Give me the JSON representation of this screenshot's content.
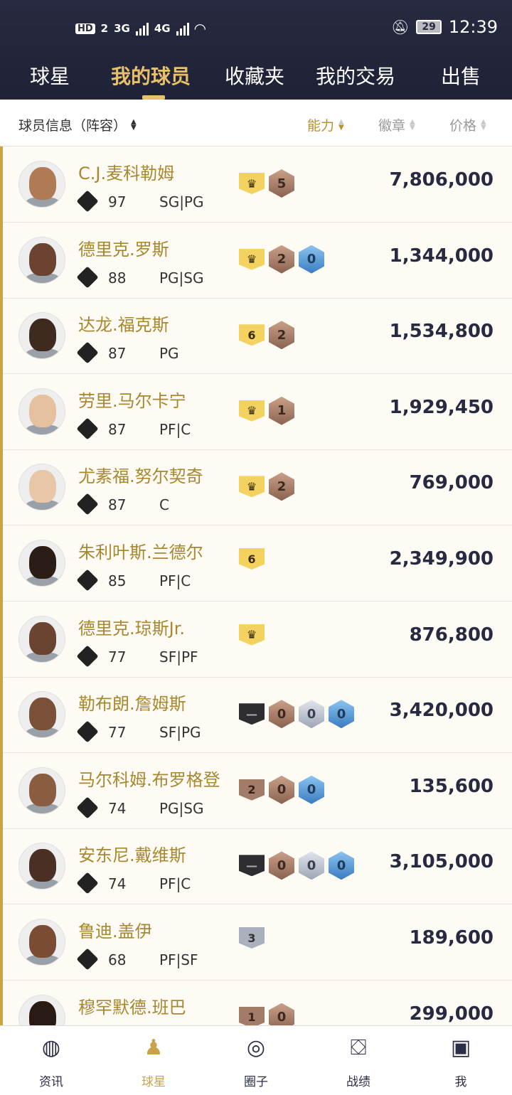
{
  "status_bar": {
    "hd": "HD",
    "sim": "2",
    "net1": "3G",
    "net2": "4G",
    "battery": "29",
    "time": "12:39"
  },
  "top_tabs": [
    "球星",
    "我的球员",
    "收藏夹",
    "我的交易",
    "出售"
  ],
  "sort_bar": {
    "info": "球员信息（阵容）",
    "ability": "能力",
    "badge": "徽章",
    "price": "价格"
  },
  "players": [
    {
      "name": "C.J.麦科勒姆",
      "rating": "97",
      "pos": "SG|PG",
      "price": "7,806,000",
      "badges": [
        {
          "t": "shield",
          "c": "gold",
          "v": "♛"
        },
        {
          "t": "hex",
          "c": "bronze",
          "v": "5"
        }
      ]
    },
    {
      "name": "德里克.罗斯",
      "rating": "88",
      "pos": "PG|SG",
      "price": "1,344,000",
      "badges": [
        {
          "t": "shield",
          "c": "gold",
          "v": "♛"
        },
        {
          "t": "hex",
          "c": "bronze",
          "v": "2"
        },
        {
          "t": "hex",
          "c": "blue",
          "v": "0"
        }
      ]
    },
    {
      "name": "达龙.福克斯",
      "rating": "87",
      "pos": "PG",
      "price": "1,534,800",
      "badges": [
        {
          "t": "shield",
          "c": "gold",
          "v": "6"
        },
        {
          "t": "hex",
          "c": "bronze",
          "v": "2"
        }
      ]
    },
    {
      "name": "劳里.马尔卡宁",
      "rating": "87",
      "pos": "PF|C",
      "price": "1,929,450",
      "badges": [
        {
          "t": "shield",
          "c": "gold",
          "v": "♛"
        },
        {
          "t": "hex",
          "c": "bronze",
          "v": "1"
        }
      ]
    },
    {
      "name": "尤素福.努尔契奇",
      "rating": "87",
      "pos": "C",
      "price": "769,000",
      "badges": [
        {
          "t": "shield",
          "c": "gold",
          "v": "♛"
        },
        {
          "t": "hex",
          "c": "bronze",
          "v": "2"
        }
      ]
    },
    {
      "name": "朱利叶斯.兰德尔",
      "rating": "85",
      "pos": "PF|C",
      "price": "2,349,900",
      "badges": [
        {
          "t": "shield",
          "c": "gold",
          "v": "6"
        }
      ]
    },
    {
      "name": "德里克.琼斯Jr.",
      "rating": "77",
      "pos": "SF|PF",
      "price": "876,800",
      "badges": [
        {
          "t": "shield",
          "c": "gold",
          "v": "♛"
        }
      ]
    },
    {
      "name": "勒布朗.詹姆斯",
      "rating": "77",
      "pos": "SF|PG",
      "price": "3,420,000",
      "badges": [
        {
          "t": "shield",
          "c": "dark",
          "v": "—"
        },
        {
          "t": "hex",
          "c": "bronze",
          "v": "0"
        },
        {
          "t": "hex",
          "c": "silver",
          "v": "0"
        },
        {
          "t": "hex",
          "c": "blue",
          "v": "0"
        }
      ]
    },
    {
      "name": "马尔科姆.布罗格登",
      "rating": "74",
      "pos": "PG|SG",
      "price": "135,600",
      "badges": [
        {
          "t": "shield",
          "c": "bronze",
          "v": "2"
        },
        {
          "t": "hex",
          "c": "bronze",
          "v": "0"
        },
        {
          "t": "hex",
          "c": "blue",
          "v": "0"
        }
      ]
    },
    {
      "name": "安东尼.戴维斯",
      "rating": "74",
      "pos": "PF|C",
      "price": "3,105,000",
      "badges": [
        {
          "t": "shield",
          "c": "dark",
          "v": "—"
        },
        {
          "t": "hex",
          "c": "bronze",
          "v": "0"
        },
        {
          "t": "hex",
          "c": "silver",
          "v": "0"
        },
        {
          "t": "hex",
          "c": "blue",
          "v": "0"
        }
      ]
    },
    {
      "name": "鲁迪.盖伊",
      "rating": "68",
      "pos": "PF|SF",
      "price": "189,600",
      "badges": [
        {
          "t": "shield",
          "c": "silverb",
          "v": "3"
        }
      ]
    },
    {
      "name": "穆罕默德.班巴",
      "rating": "",
      "pos": "",
      "price": "299,000",
      "badges": [
        {
          "t": "shield",
          "c": "bronze",
          "v": "1"
        },
        {
          "t": "hex",
          "c": "bronze",
          "v": "0"
        }
      ]
    }
  ],
  "bottom_nav": [
    "资讯",
    "球星",
    "圈子",
    "战绩",
    "我"
  ],
  "colors": {
    "accent": "#c9a24a",
    "header": "#272a40",
    "name": "#a8872f"
  }
}
